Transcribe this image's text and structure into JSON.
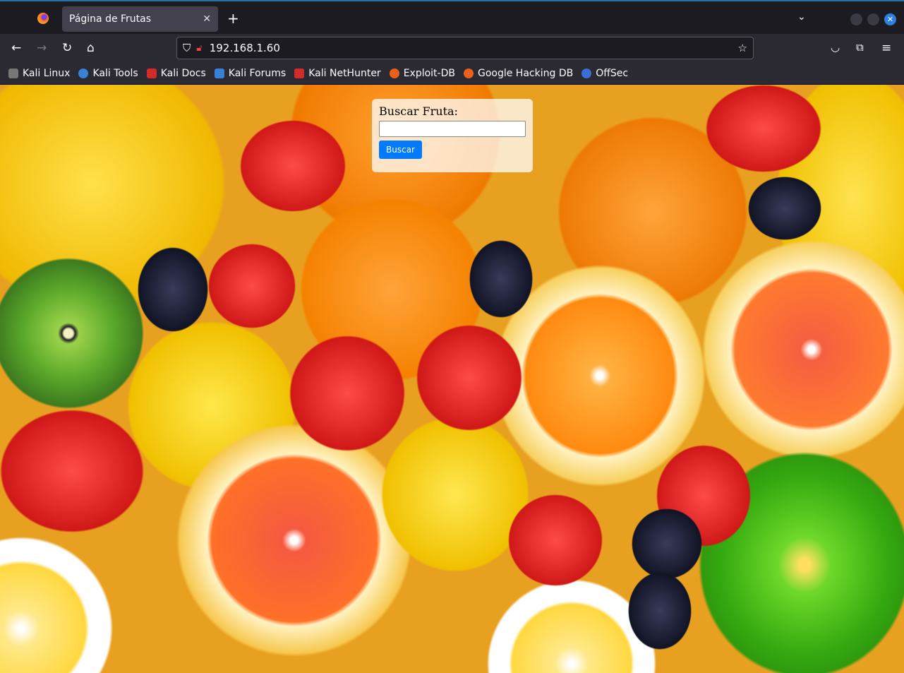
{
  "browser": {
    "tab_title": "Página de Frutas",
    "url": "192.168.1.60",
    "bookmarks": [
      {
        "label": "Kali Linux",
        "color": "#cccccc"
      },
      {
        "label": "Kali Tools",
        "color": "#3a7fd8"
      },
      {
        "label": "Kali Docs",
        "color": "#d42a2a"
      },
      {
        "label": "Kali Forums",
        "color": "#3a7fd8"
      },
      {
        "label": "Kali NetHunter",
        "color": "#d42a2a"
      },
      {
        "label": "Exploit-DB",
        "color": "#e8601c"
      },
      {
        "label": "Google Hacking DB",
        "color": "#e8601c"
      },
      {
        "label": "OffSec",
        "color": "#3a6fd8"
      }
    ]
  },
  "page": {
    "heading": "Buscar Fruta:",
    "search_value": "",
    "button_label": "Buscar"
  }
}
